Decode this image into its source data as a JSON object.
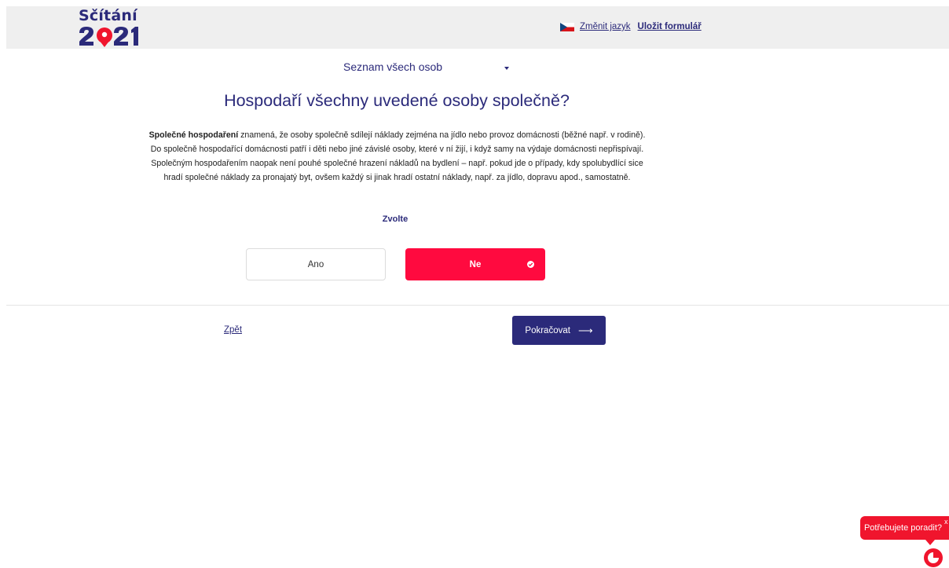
{
  "header": {
    "logo_text": "Sčítání",
    "logo_year": "2021",
    "change_language": "Změnit jazyk",
    "save_form": "Uložit formulář",
    "flag": "czech-flag-icon"
  },
  "persons_dropdown": {
    "label": "Seznam všech osob"
  },
  "question": {
    "title": "Hospodaří všechny uvedené osoby společně?",
    "info_bold": "Společné hospodaření",
    "info_text": " znamená, že osoby společně sdílejí náklady zejména na jídlo nebo provoz domácnosti (běžné např. v rodině). Do společně hospodařící domácnosti patří i děti nebo jiné závislé osoby, které v ní žijí, i když samy na výdaje domácnosti nepřispívají. Společným hospodařením naopak není pouhé společné hrazení nákladů na bydlení – např. pokud jde o případy, kdy spolubydlící sice hradí společné náklady za pronajatý byt, ovšem každý si jinak hradí ostatní náklady, např. za jídlo, dopravu apod., samostatně.",
    "choose_label": "Zvolte"
  },
  "options": [
    {
      "label": "Ano",
      "selected": false
    },
    {
      "label": "Ne",
      "selected": true
    }
  ],
  "nav": {
    "back": "Zpět",
    "continue": "Pokračovat",
    "continue_icon": "arrow-right-icon"
  },
  "help": {
    "label": "Potřebujete poradit?",
    "close": "x"
  },
  "colors": {
    "primary": "#2b2a7a",
    "accent": "#ff0a3f",
    "header_bg": "#efefef"
  }
}
